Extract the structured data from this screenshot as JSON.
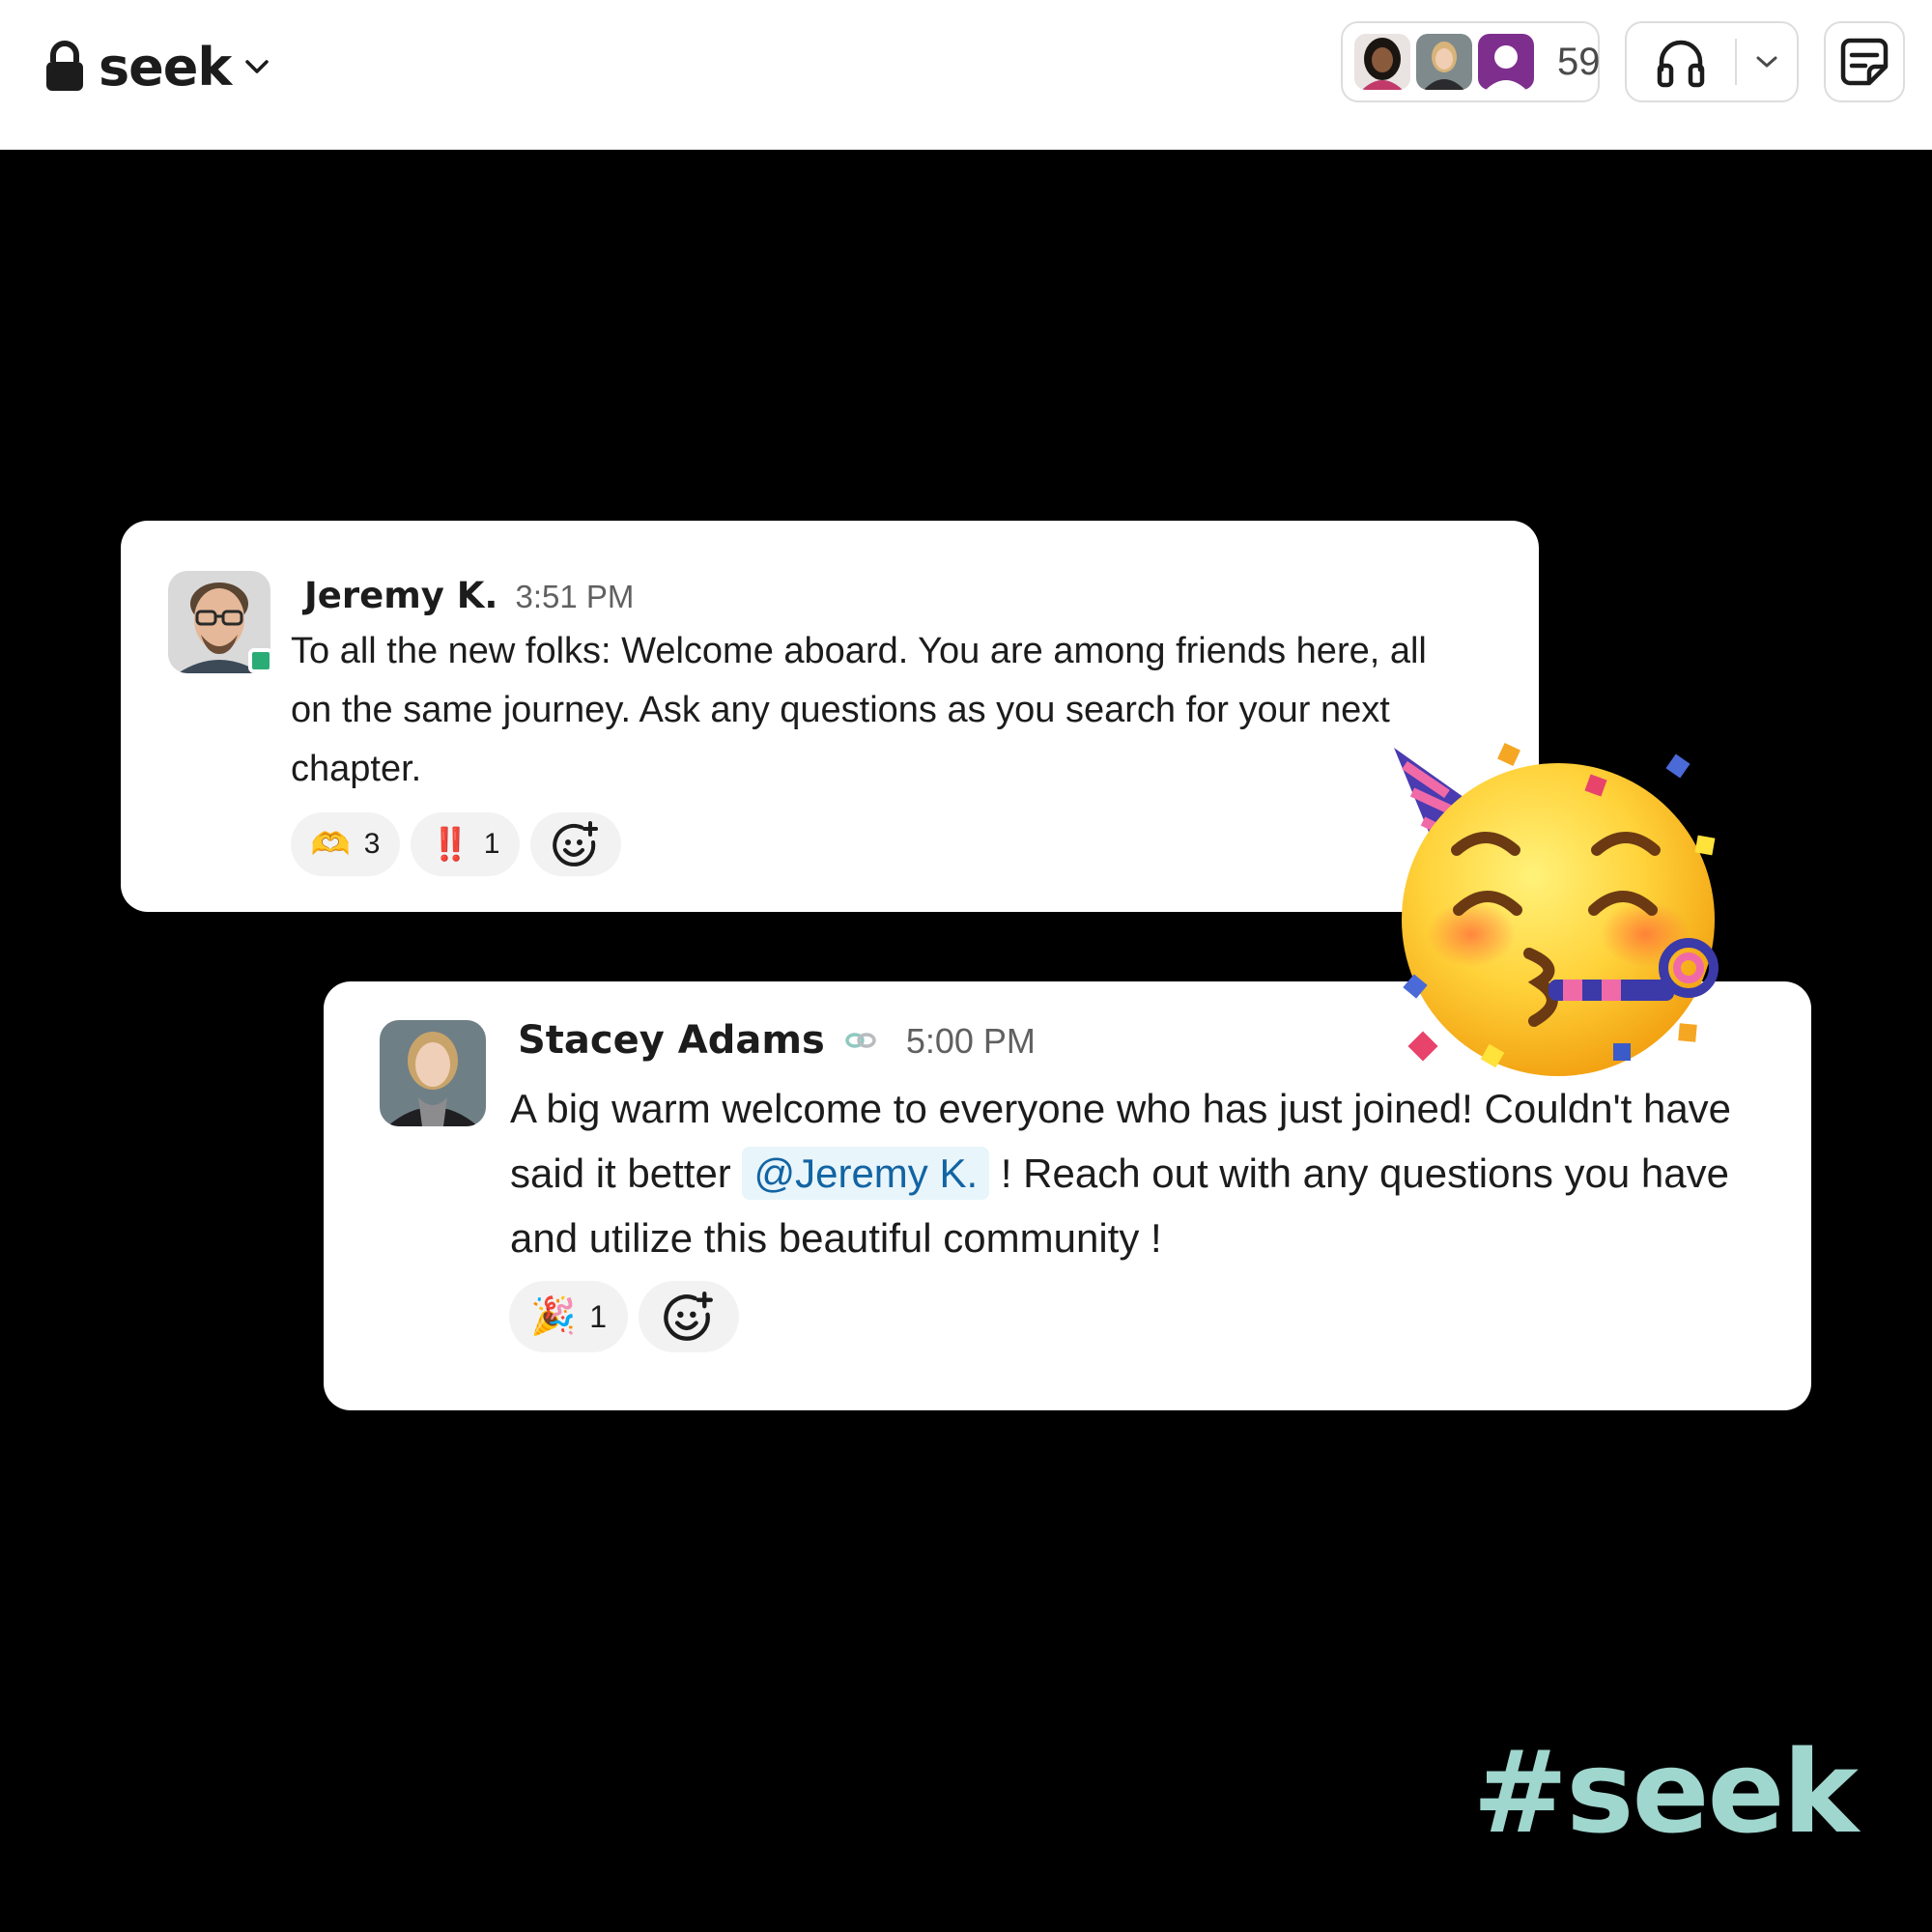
{
  "header": {
    "channel_name": "seek",
    "member_count": "59",
    "icons": [
      "lock-icon",
      "chevron-down-icon",
      "headphones-icon",
      "chevron-down-icon",
      "canvas-icon"
    ]
  },
  "messages": [
    {
      "author": "Jeremy K.",
      "time": "3:51 PM",
      "text": "To all the new folks:  Welcome aboard. You are among friends here, all on the same journey.  Ask any questions as you search for your next chapter.",
      "status": "online",
      "reactions": [
        {
          "emoji": "🫶",
          "icon": "heart-hands-icon",
          "count": "3"
        },
        {
          "emoji": "‼️",
          "icon": "double-exclamation-icon",
          "count": "1"
        }
      ]
    },
    {
      "author": "Stacey Adams",
      "time": "5:00 PM",
      "text_before": "A big warm welcome to everyone who has just joined! Couldn't have said it better ",
      "mention": "@Jeremy K.",
      "text_after": " ! Reach out with any questions you have and utilize this beautiful community !",
      "reactions": [
        {
          "emoji": "🎉",
          "icon": "party-popper-icon",
          "count": "1"
        }
      ]
    }
  ],
  "hashtag": "#seek",
  "colors": {
    "background": "#000000",
    "card": "#ffffff",
    "mention_bg": "#e8f5fa",
    "mention_text": "#1264a3",
    "hashtag": "#9fd6ce",
    "presence": "#2bac76"
  }
}
